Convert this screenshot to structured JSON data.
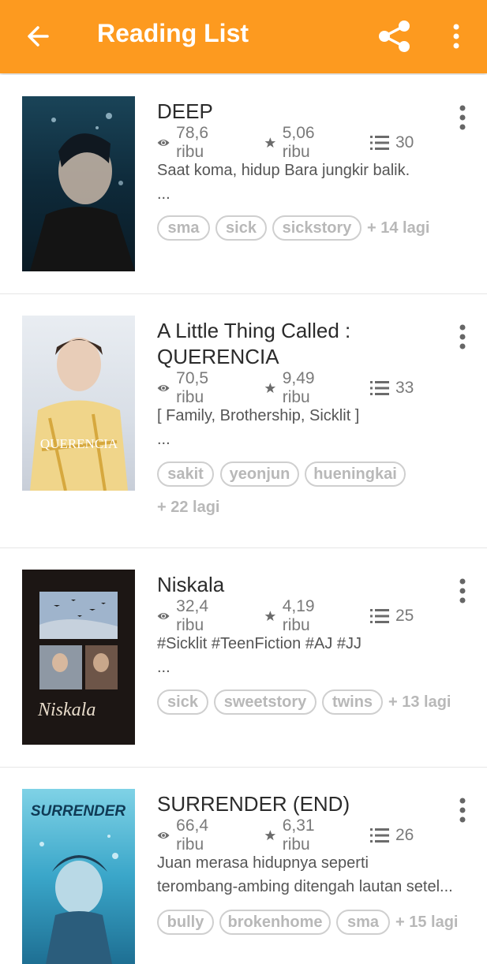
{
  "app_bar": {
    "title": "Reading List",
    "background": "#fd9a1f"
  },
  "stories": [
    {
      "title": "DEEP",
      "views": "78,6 ribu",
      "votes": "5,06 ribu",
      "parts": "30",
      "description": [
        "Saat koma, hidup Bara jungkir balik.",
        "..."
      ],
      "tags": [
        "sma",
        "sick",
        "sickstory"
      ],
      "more_tags": "+ 14 lagi"
    },
    {
      "title": "A Little Thing Called :",
      "title_line2": "QUERENCIA",
      "views": "70,5 ribu",
      "votes": "9,49 ribu",
      "parts": "33",
      "description": [
        "[ Family, Brothership, Sicklit ]",
        "..."
      ],
      "tags": [
        "sakit",
        "yeonjun",
        "hueningkai"
      ],
      "more_tags": "+ 22 lagi",
      "cover_text": "QUERENCIA"
    },
    {
      "title": "Niskala",
      "views": "32,4 ribu",
      "votes": "4,19 ribu",
      "parts": "25",
      "description": [
        "#Sicklit #TeenFiction #AJ #JJ",
        "..."
      ],
      "tags": [
        "sick",
        "sweetstory",
        "twins"
      ],
      "more_tags": "+ 13 lagi",
      "cover_text": "Niskala"
    },
    {
      "title": "SURRENDER (END)",
      "views": "66,4 ribu",
      "votes": "6,31 ribu",
      "parts": "26",
      "description": [
        "Juan merasa hidupnya seperti",
        "terombang-ambing ditengah lautan setel..."
      ],
      "tags": [
        "bully",
        "brokenhome",
        "sma"
      ],
      "more_tags": "+ 15 lagi",
      "cover_text": "SURRENDER"
    }
  ]
}
